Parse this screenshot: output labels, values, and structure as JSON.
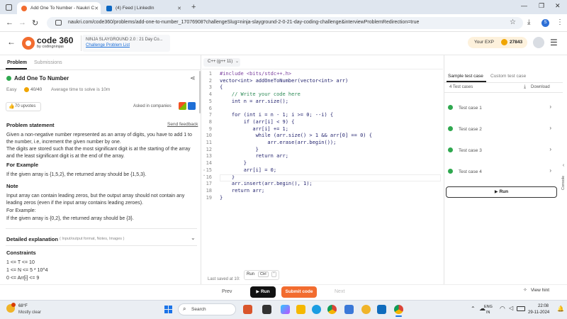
{
  "browser": {
    "tabs": [
      {
        "title": "Add One To Number - Naukri C"
      },
      {
        "title": "(4) Feed | LinkedIn"
      }
    ],
    "url": "naukri.com/code360/problems/add-one-to-number_17076908?challengeSlug=ninja-slayground-2-0-21-day-coding-challenge&interviewProblemRedirection=true",
    "profile_initial": "S"
  },
  "header": {
    "logo_main": "code 360",
    "logo_sub": "by codingninjas",
    "challenge_title": "NINJA SLAYGROUND 2.0 : 21 Day Co...",
    "challenge_link": "Challenge Problem List",
    "exp_label": "Your EXP",
    "exp_value": "27843"
  },
  "left": {
    "tabs": {
      "problem": "Problem",
      "submissions": "Submissions"
    },
    "title": "Add One To Number",
    "difficulty": "Easy",
    "score": "40/40",
    "avg_time": "Average time to solve is 10m",
    "upvotes": "70 upvotes",
    "asked_in": "Asked in companies",
    "statement_heading": "Problem statement",
    "send_feedback": "Send feedback",
    "statement_p1": "Given a non-negative number represented as an array of digits, you have to add 1 to the number, i.e, increment the given number by one.",
    "statement_p2": "The digits are stored such that the most significant digit is at the starting of the array and the least significant digit is at the end of the array.",
    "example_heading": "For Example",
    "example_text": "If the given array is {1,5,2}, the returned array should be {1,5,3}.",
    "note_heading": "Note",
    "note_text": "Input array can contain leading zeros, but the output array should not contain any leading zeros (even if the input array contains leading zeroes).",
    "note_example_label": "For Example:",
    "note_example": "If the given array is {0,2}, the returned array should be {3}.",
    "detailed_heading": "Detailed explanation",
    "detailed_sub": "( Input/output format, Notes, Images )",
    "constraints_heading": "Constraints",
    "constraints": [
      "1 <= T <= 10",
      "1 <= N <= 5 * 10^4",
      "0 <= Arr[i] <= 9"
    ]
  },
  "editor": {
    "language": "C++ (g++ 11)",
    "last_saved": "Last saved at 10:",
    "run_hint": "Run",
    "run_hint_key": "Ctrl",
    "run_hint_key2": "'",
    "lines": [
      "#include <bits/stdc++.h>",
      "vector<int> addOneToNumber(vector<int> arr)",
      "{",
      "    // Write your code here",
      "    int n = arr.size();",
      "",
      "    for (int i = n - 1; i >= 0; --i) {",
      "        if (arr[i] < 9) {",
      "           arr[i] += 1;",
      "            while (arr.size() > 1 && arr[0] == 0) {",
      "                arr.erase(arr.begin());",
      "            }",
      "            return arr;",
      "        }",
      "        arr[i] = 0;",
      "    }",
      "    arr.insert(arr.begin(), 1);",
      "    return arr;",
      "}"
    ],
    "line_numbers": [
      "1",
      "2",
      "3",
      "4",
      "5",
      "6",
      "7",
      "8",
      "9",
      "10",
      "11",
      "12",
      "13",
      "14",
      "15",
      "16",
      "17",
      "18",
      "19"
    ]
  },
  "right": {
    "tab_sample": "Sample test case",
    "tab_custom": "Custom test case",
    "test_count": "4 Test cases",
    "download": "Download",
    "test_cases": [
      "Test case 1",
      "Test case 2",
      "Test case 3",
      "Test case 4"
    ],
    "run_button": "Run",
    "console": "Console"
  },
  "footer": {
    "prev": "Prev",
    "run": "Run",
    "submit": "Submit code",
    "next": "Next",
    "view_hint": "View hint"
  },
  "taskbar": {
    "weather_temp": "68°F",
    "weather_desc": "Mostly clear",
    "search": "Search",
    "lang1": "ENG",
    "lang2": "IN",
    "time": "22:08",
    "date": "29-11-2024"
  },
  "colors": {
    "accent_orange": "#f26c2f",
    "success_green": "#2fa84f",
    "link_blue": "#1a6ed8",
    "exp_bg": "#fdf1dc"
  }
}
